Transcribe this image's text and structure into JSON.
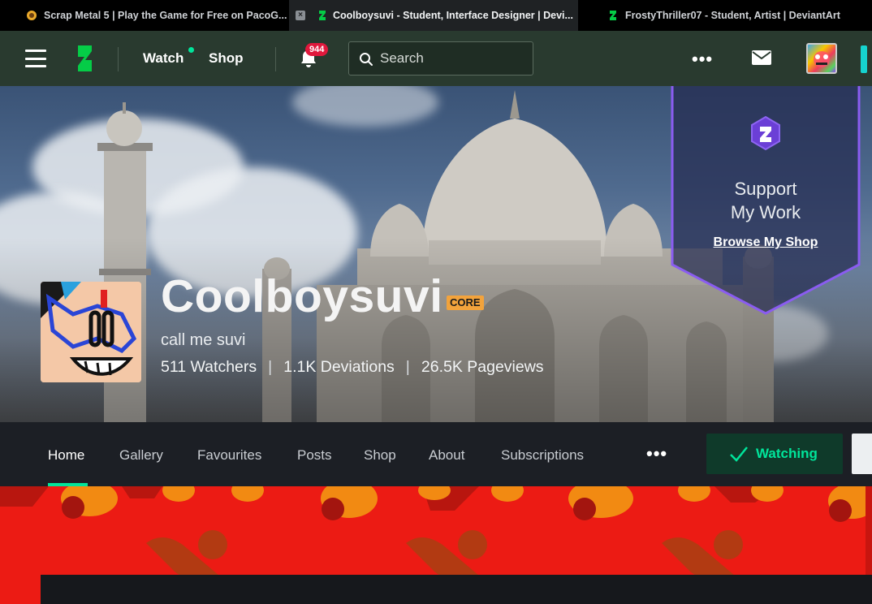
{
  "browser": {
    "tabs": [
      {
        "title": "Scrap Metal 5 | Play the Game for Free on PacoG...",
        "active": false
      },
      {
        "title": "Coolboysuvi - Student, Interface Designer | Devi...",
        "active": true
      },
      {
        "title": "FrostyThriller07 - Student, Artist | DeviantArt",
        "active": false
      }
    ]
  },
  "header": {
    "watch_label": "Watch",
    "shop_label": "Shop",
    "notification_count": "944",
    "search_placeholder": "Search",
    "more_label": "•••"
  },
  "banner": {
    "support_title": "Support\nMy Work",
    "support_link": "Browse My Shop"
  },
  "profile": {
    "name": "Coolboysuvi",
    "badge": "CORE",
    "tagline": "call me suvi",
    "stats": {
      "watchers": "511 Watchers",
      "deviations": "1.1K Deviations",
      "pageviews": "26.5K Pageviews",
      "separator": "|"
    }
  },
  "profile_nav": {
    "tabs": [
      "Home",
      "Gallery",
      "Favourites",
      "Posts",
      "Shop",
      "About",
      "Subscriptions"
    ],
    "active": "Home",
    "more_label": "•••",
    "watching_label": "Watching"
  },
  "colors": {
    "header_bg": "#293a2f",
    "accent_green": "#00e59b",
    "notification_red": "#e0183c",
    "core_badge": "#f2a33c",
    "support_purple": "#8a5cf0",
    "pattern_red": "#ec1b14",
    "pattern_orange": "#f28a12"
  }
}
